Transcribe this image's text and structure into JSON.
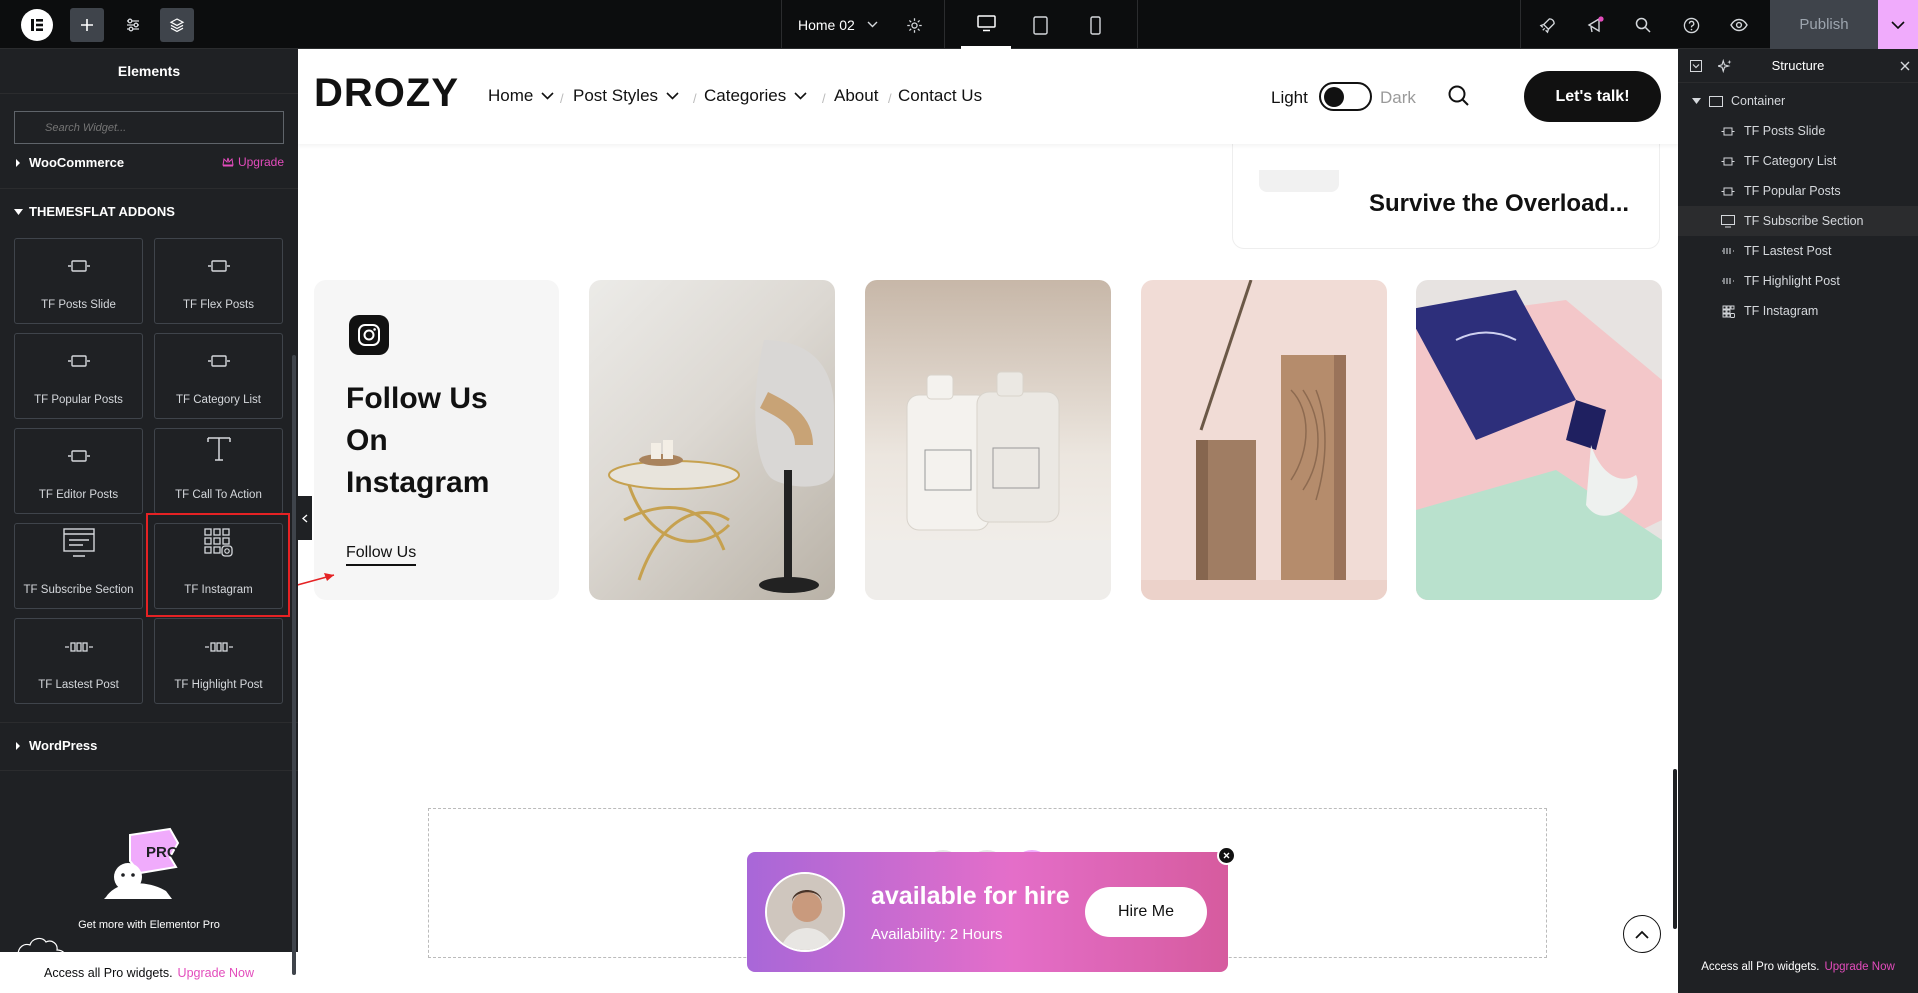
{
  "topbar": {
    "page_name": "Home 02",
    "publish_label": "Publish"
  },
  "elements_panel": {
    "title": "Elements",
    "search_placeholder": "Search Widget...",
    "categories": {
      "woocommerce": "WooCommerce",
      "upgrade": "Upgrade",
      "themesflat": "THEMESFLAT ADDONS",
      "wordpress": "WordPress"
    },
    "widgets": [
      {
        "label": "TF Posts Slide",
        "icon": "slides-icon"
      },
      {
        "label": "TF Flex Posts",
        "icon": "slides-icon"
      },
      {
        "label": "TF Popular Posts",
        "icon": "slides-icon"
      },
      {
        "label": "TF Category List",
        "icon": "slides-icon"
      },
      {
        "label": "TF Editor Posts",
        "icon": "slides-icon"
      },
      {
        "label": "TF Call To Action",
        "icon": "text-t-icon"
      },
      {
        "label": "TF Subscribe Section",
        "icon": "subscribe-icon"
      },
      {
        "label": "TF Instagram",
        "icon": "instagram-grid-icon"
      },
      {
        "label": "TF Lastest Post",
        "icon": "posts-row-icon"
      },
      {
        "label": "TF Highlight Post",
        "icon": "posts-row-icon"
      }
    ],
    "promo_text": "Get more with Elementor Pro",
    "promo_badge": "PRO",
    "footer_text": "Access all Pro widgets.",
    "footer_link": "Upgrade Now"
  },
  "site": {
    "logo": "DROZY",
    "nav": [
      {
        "label": "Home",
        "dropdown": true
      },
      {
        "label": "Post Styles",
        "dropdown": true
      },
      {
        "label": "Categories",
        "dropdown": true
      },
      {
        "label": "About",
        "dropdown": false
      },
      {
        "label": "Contact Us",
        "dropdown": false
      }
    ],
    "nav_separator": "/",
    "theme_light": "Light",
    "theme_dark": "Dark",
    "cta": "Let's talk!",
    "card_title": "Survive the Overload...",
    "insta_heading_1": "Follow Us",
    "insta_heading_2": "On",
    "insta_heading_3": "Instagram",
    "insta_link": "Follow Us",
    "hire_title": "available for hire",
    "hire_sub": "Availability: 2 Hours",
    "hire_button": "Hire Me"
  },
  "structure_panel": {
    "title": "Structure",
    "root": "Container",
    "items": [
      "TF Posts Slide",
      "TF Category List",
      "TF Popular Posts",
      "TF Subscribe Section",
      "TF Lastest Post",
      "TF Highlight Post",
      "TF Instagram"
    ],
    "footer_text": "Access all Pro widgets.",
    "footer_link": "Upgrade Now"
  },
  "colors": {
    "accent_pink": "#e34cbc",
    "panel_bg": "#1f2124",
    "highlight_red": "#e52224"
  }
}
